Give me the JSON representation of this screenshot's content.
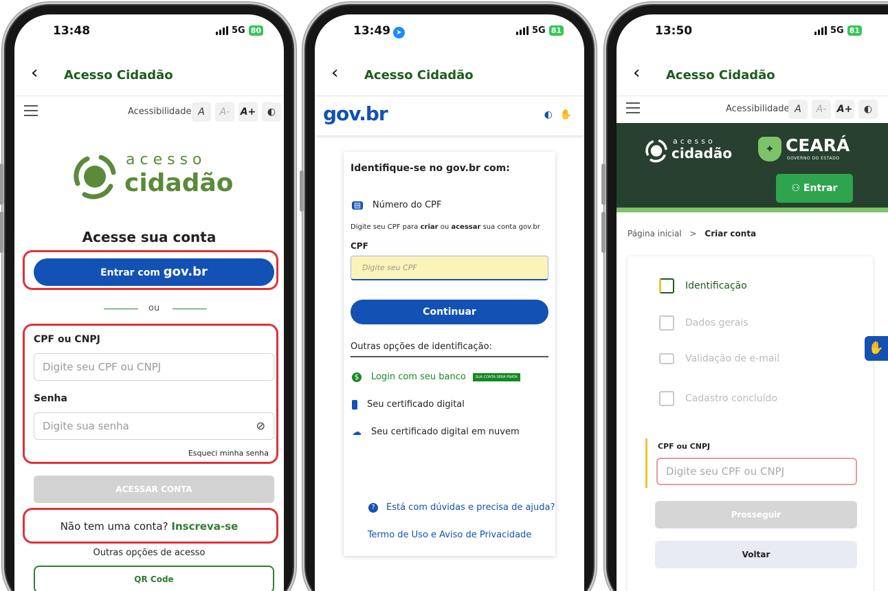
{
  "phone1": {
    "time": "13:48",
    "network": "5G",
    "battery": "80",
    "app_title": "Acesso Cidadão",
    "accessibility": {
      "label": "Acessibilidade",
      "a_label": "A",
      "a_minus": "A-",
      "a_plus": "A+"
    },
    "logo": {
      "top_word": "acesso",
      "bottom_word": "cidadão"
    },
    "heading": "Acesse sua conta",
    "govbr_button": {
      "prefix": "Entrar com",
      "brand": "gov.br"
    },
    "or_label": "ou",
    "cpf": {
      "label": "CPF ou CNPJ",
      "placeholder": "Digite seu CPF ou CNPJ"
    },
    "senha": {
      "label": "Senha",
      "placeholder": "Digite sua senha"
    },
    "forgot_link": "Esqueci minha senha",
    "access_button": "ACESSAR CONTA",
    "signup": {
      "text": "Não tem uma conta?",
      "link": "Inscreva-se"
    },
    "other_options": "Outras opções de acesso",
    "qr_button": "QR Code"
  },
  "phone2": {
    "time": "13:49",
    "network": "5G",
    "battery": "81",
    "app_title": "Acesso Cidadão",
    "brand": "gov.br",
    "card_title": "Identifique-se no gov.br com:",
    "cpf_option": "Número do CPF",
    "instruction": {
      "a": "Digite seu CPF para ",
      "b": "criar",
      "c": " ou ",
      "d": "acessar",
      "e": " sua conta gov.br"
    },
    "cpf_label": "CPF",
    "cpf_placeholder": "Digite seu CPF",
    "continue_button": "Continuar",
    "other_title": "Outras opções de identificação:",
    "options": [
      "Login com seu banco",
      "Seu certificado digital",
      "Seu certificado digital em nuvem"
    ],
    "bank_badge": "SUA CONTA SERÁ PRATA",
    "help_link": "Está com dúvidas e precisa de ajuda?",
    "terms_link": "Termo de Uso e Aviso de Privacidade"
  },
  "phone3": {
    "time": "13:50",
    "network": "5G",
    "battery": "81",
    "app_title": "Acesso Cidadão",
    "accessibility": {
      "label": "Acessibilidade",
      "a_label": "A",
      "a_minus": "A-",
      "a_plus": "A+"
    },
    "logo": {
      "top_word": "acesso",
      "bottom_word": "cidadão"
    },
    "ceara": {
      "name": "CEARÁ",
      "sub": "GOVERNO DO ESTADO"
    },
    "enter_button": "Entrar",
    "breadcrumb": {
      "home": "Página inicial",
      "sep": ">",
      "current": "Criar conta"
    },
    "steps": [
      "Identificação",
      "Dados gerais",
      "Validação de e-mail",
      "Cadastro concluído"
    ],
    "cpf": {
      "label": "CPF ou CNPJ",
      "placeholder": "Digite seu CPF ou CNPJ"
    },
    "proceed_button": "Prosseguir",
    "back_button": "Voltar"
  },
  "colors": {
    "green_dark": "#1d5a1d",
    "green_logo": "#5b8a3a",
    "govbr_blue": "#1351b4",
    "highlight_red": "#e0303a",
    "ceara_dark": "#27402f",
    "ceara_green": "#2ea44f"
  }
}
